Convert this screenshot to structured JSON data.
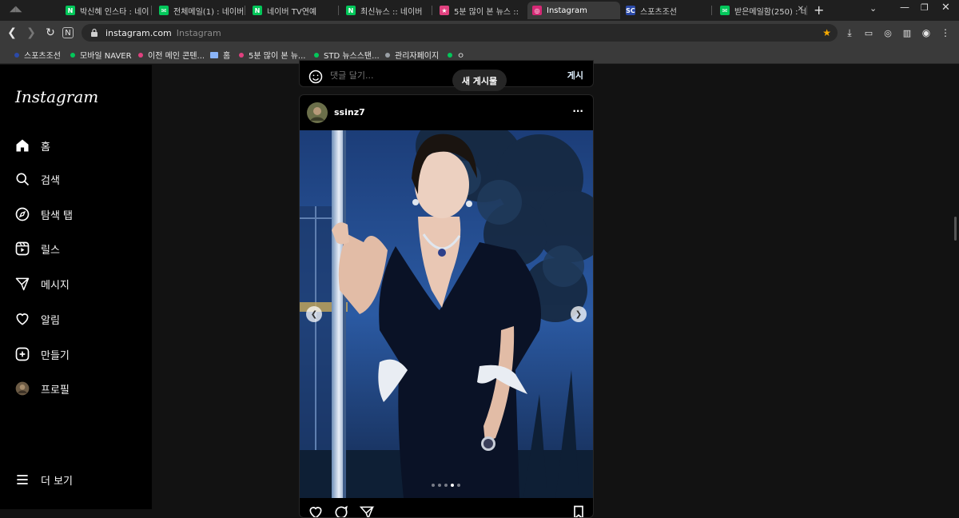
{
  "browser": {
    "tabs": [
      {
        "label": "박신혜 인스타 : 네이",
        "color": "#03c75a",
        "glyph": "N"
      },
      {
        "label": "전체메일(1) : 네이버",
        "color": "#03c75a",
        "glyph": "✉"
      },
      {
        "label": "네이버 TV연예",
        "color": "#03c75a",
        "glyph": "N"
      },
      {
        "label": "최신뉴스 :: 네이버",
        "color": "#03c75a",
        "glyph": "N"
      },
      {
        "label": "5분 많이 본 뉴스 ::",
        "color": "#e0417f",
        "glyph": "★"
      },
      {
        "label": "Instagram",
        "color": "#d62976",
        "glyph": "◎"
      },
      {
        "label": "스포츠조선",
        "color": "#2b4aa8",
        "glyph": "SC"
      },
      {
        "label": "받은메일함(250) : 네",
        "color": "#03c75a",
        "glyph": "✉"
      }
    ],
    "new_tab": "+",
    "url_domain": "instagram.com",
    "url_title": "Instagram",
    "bookmarks": [
      {
        "label": "스포츠조선",
        "color": "#2b4aa8"
      },
      {
        "label": "모바일 NAVER",
        "color": "#03c75a"
      },
      {
        "label": "이전 메인 콘텐...",
        "color": "#e0417f"
      },
      {
        "label": "홈",
        "color": "#8ab4f8"
      },
      {
        "label": "5분 많이 본 뉴...",
        "color": "#e0417f"
      },
      {
        "label": "STD 뉴스스탠...",
        "color": "#03c75a"
      },
      {
        "label": "관리자페이지",
        "color": "#9aa0a6"
      },
      {
        "label": "ㅇ",
        "color": "#03c75a"
      }
    ]
  },
  "sidebar": {
    "logo": "Instagram",
    "items": [
      {
        "label": "홈",
        "icon": "home-icon"
      },
      {
        "label": "검색",
        "icon": "search-icon"
      },
      {
        "label": "탐색 탭",
        "icon": "compass-icon"
      },
      {
        "label": "릴스",
        "icon": "reels-icon"
      },
      {
        "label": "메시지",
        "icon": "send-icon"
      },
      {
        "label": "알림",
        "icon": "heart-icon"
      },
      {
        "label": "만들기",
        "icon": "plus-square-icon"
      },
      {
        "label": "프로필",
        "icon": "avatar"
      }
    ],
    "more": "더 보기"
  },
  "feed": {
    "comment_placeholder": "댓글 달기...",
    "post_button": "게시",
    "new_posts_toast": "새 게시물",
    "post": {
      "username": "ssinz7",
      "more": "···",
      "carousel_dots": 5,
      "carousel_active": 3
    }
  }
}
